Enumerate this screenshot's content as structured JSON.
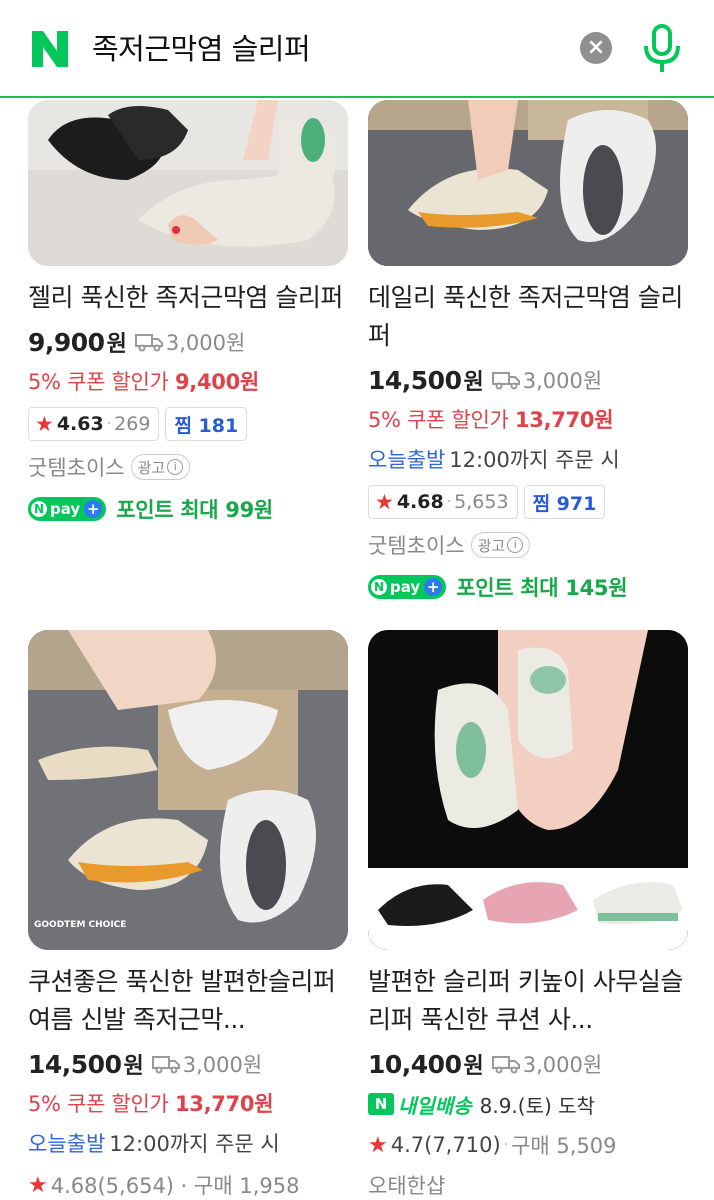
{
  "search": {
    "query": "족저근막염 슬리퍼"
  },
  "products": [
    {
      "title": "젤리 푹신한 족저근막염 슬리퍼",
      "price": "9,900",
      "unit": "원",
      "shipping": "3,000원",
      "coupon_prefix": "5% 쿠폰 할인가",
      "coupon_price": "9,400원",
      "rating": "4.63",
      "rating_count": "269",
      "zzim": "찜 181",
      "shop": "굿템초이스",
      "ad": "광고",
      "point": "포인트 최대 99원"
    },
    {
      "title": "데일리 푹신한 족저근막염 슬리퍼",
      "price": "14,500",
      "unit": "원",
      "shipping": "3,000원",
      "coupon_prefix": "5% 쿠폰 할인가",
      "coupon_price": "13,770원",
      "today_label": "오늘출발",
      "today_cutoff": "12:00까지 주문 시",
      "rating": "4.68",
      "rating_count": "5,653",
      "zzim": "찜 971",
      "shop": "굿템초이스",
      "ad": "광고",
      "point": "포인트 최대 145원"
    },
    {
      "title": "쿠션좋은 푹신한 발편한슬리퍼 여름 신발 족저근막...",
      "price": "14,500",
      "unit": "원",
      "shipping": "3,000원",
      "coupon_prefix": "5% 쿠폰 할인가",
      "coupon_price": "13,770원",
      "today_label": "오늘출발",
      "today_cutoff": "12:00까지 주문 시",
      "rating_partial": "4.68(5,654) · 구매 1,958",
      "image_watermark": "GOODTEM CHOICE"
    },
    {
      "title": "발편한 슬리퍼 키높이 사무실슬리퍼 푹신한 쿠션 사...",
      "price": "10,400",
      "unit": "원",
      "shipping": "3,000원",
      "delivery_badge": "내일배송",
      "delivery_date": "8.9.(토) 도착",
      "rating_inline": "4.7(7,710)",
      "purchase": "구매 5,509",
      "shop_partial": "오태한샵"
    }
  ],
  "npay": {
    "label": "pay"
  }
}
